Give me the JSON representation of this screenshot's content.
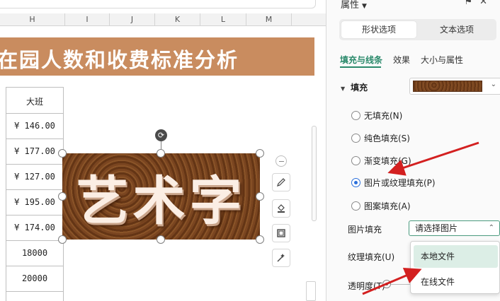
{
  "sheet": {
    "columns": [
      "H",
      "I",
      "J",
      "K",
      "L",
      "M"
    ],
    "title": "在园人数和收费标准分析",
    "table_header": "大班",
    "rows": [
      "¥ 146.00",
      "¥ 177.00",
      "¥ 127.00",
      "¥ 195.00",
      "¥ 174.00",
      "18000",
      "20000"
    ]
  },
  "art_object": {
    "text": "艺术字",
    "texture": "leather-brown"
  },
  "floating_toolbar": [
    "minus-icon",
    "pen-icon",
    "fill-bucket-icon",
    "frame-icon",
    "magic-icon"
  ],
  "panel": {
    "title": "属性",
    "header_icons": [
      "pin-icon",
      "close-icon"
    ],
    "segments": [
      "形状选项",
      "文本选项"
    ],
    "subtabs": [
      "填充与线条",
      "效果",
      "大小与属性"
    ],
    "fill_section_label": "填充",
    "fill_options": [
      {
        "label": "无填充(N)",
        "checked": false
      },
      {
        "label": "纯色填充(S)",
        "checked": false
      },
      {
        "label": "渐变填充(G)",
        "checked": false
      },
      {
        "label": "图片或纹理填充(P)",
        "checked": true
      },
      {
        "label": "图案填充(A)",
        "checked": false
      }
    ],
    "picture_fill_label": "图片填充",
    "picture_fill_value": "请选择图片",
    "texture_fill_label": "纹理填充(U)",
    "transparency_label": "透明度(T)",
    "dropdown_items": [
      "本地文件",
      "在线文件"
    ]
  },
  "colors": {
    "title_band": "#c98c5f",
    "accent_green": "#2a8a6b",
    "annotation_red": "#d32020",
    "radio_blue": "#2a6fdb"
  }
}
